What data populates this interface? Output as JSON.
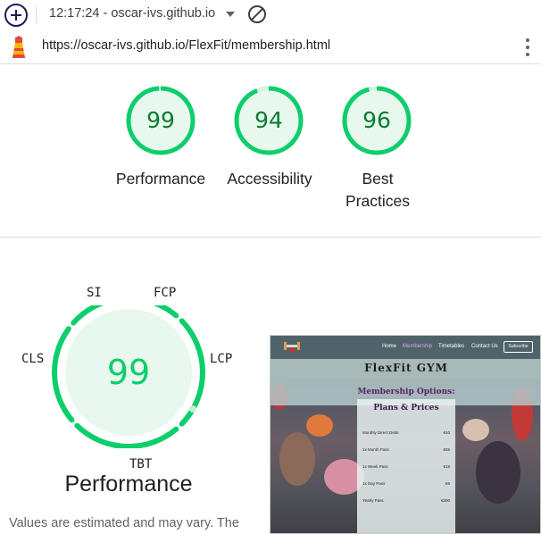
{
  "toolbar": {
    "session_label": "12:17:24 - oscar-ivs.github.io"
  },
  "urlbar": {
    "url": "https://oscar-ivs.github.io/FlexFit/membership.html"
  },
  "scores": [
    {
      "label": "Performance",
      "score": "99",
      "value": 99
    },
    {
      "label": "Accessibility",
      "score": "94",
      "value": 94
    },
    {
      "label": "Best Practices",
      "score": "96",
      "value": 96
    }
  ],
  "performance": {
    "score": "99",
    "value": 99,
    "title": "Performance",
    "metrics": {
      "si": "SI",
      "fcp": "FCP",
      "lcp": "LCP",
      "tbt": "TBT",
      "cls": "CLS"
    },
    "note": "Values are estimated and may vary. The"
  },
  "thumbnail": {
    "nav": [
      "Home",
      "Membership",
      "Timetables",
      "Contact Us"
    ],
    "subscribe": "Subscribe",
    "title": "FlexFit GYM",
    "subtitle": "Membership Options:",
    "card_title": "Plans & Prices",
    "plans": [
      {
        "name": "Monthly Direct Debit",
        "price": "€40"
      },
      {
        "name": "1x Month Pass",
        "price": "€55"
      },
      {
        "name": "1x Week Pass",
        "price": "€18"
      },
      {
        "name": "1x Day Pass",
        "price": "€8"
      },
      {
        "name": "Yearly Pass",
        "price": "€300"
      }
    ]
  },
  "colors": {
    "pass_green": "#0cce6b",
    "pass_fill": "#e8f8ee",
    "pass_text": "#0a7c30"
  }
}
